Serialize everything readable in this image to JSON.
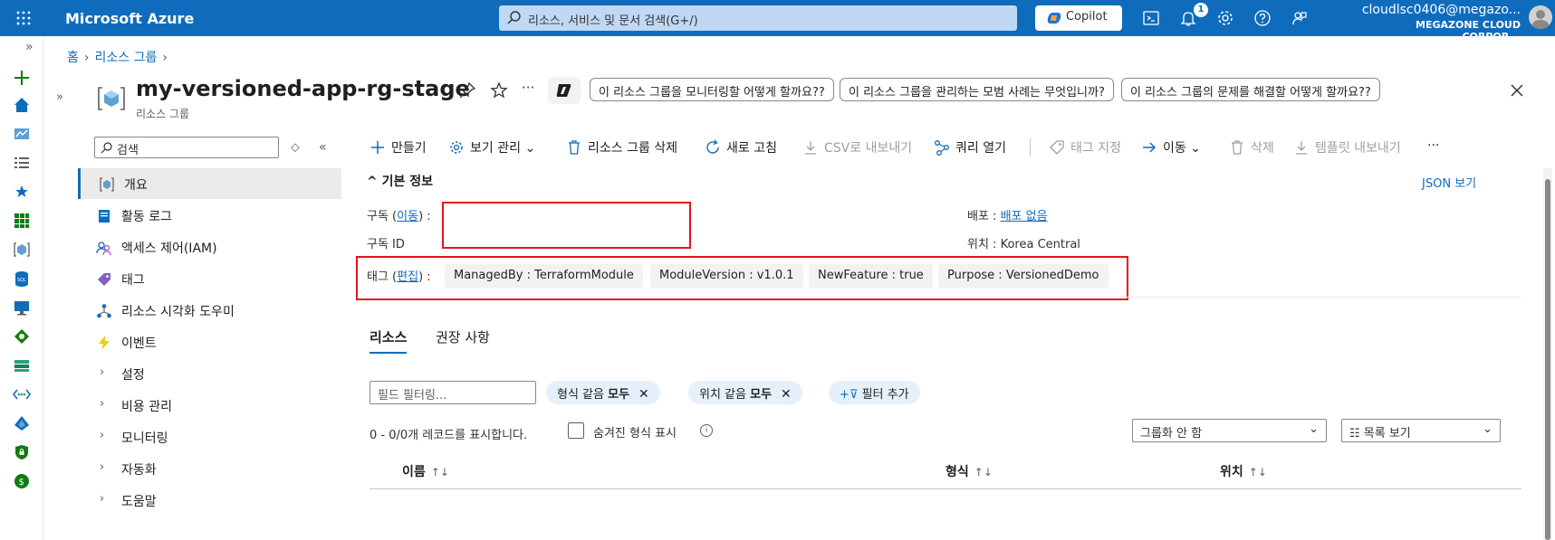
{
  "topbar": {
    "brand": "Microsoft Azure",
    "search_placeholder": "리소스, 서비스 및 문서 검색(G+/)",
    "copilot_label": "Copilot",
    "notification_count": "1",
    "user_email": "cloudlsc0406@megazo...",
    "user_org": "MEGAZONE CLOUD CORPOR..."
  },
  "breadcrumb": {
    "home": "홈",
    "resource_groups": "리소스 그룹"
  },
  "header": {
    "title": "my-versioned-app-rg-stage",
    "subtitle": "리소스 그룹",
    "more": "···",
    "suggestions": [
      "이 리소스 그룹을 모니터링할 어떻게 할까요??",
      "이 리소스 그룹을 관리하는 모범 사례는 무엇입니까?",
      "이 리소스 그룹의 문제를 해결할 어떻게 할까요??"
    ]
  },
  "menu": {
    "search_placeholder": "검색",
    "items": [
      {
        "label": "개요"
      },
      {
        "label": "활동 로그"
      },
      {
        "label": "액세스 제어(IAM)"
      },
      {
        "label": "태그"
      },
      {
        "label": "리소스 시각화 도우미"
      },
      {
        "label": "이벤트"
      },
      {
        "label": "설정"
      },
      {
        "label": "비용 관리"
      },
      {
        "label": "모니터링"
      },
      {
        "label": "자동화"
      },
      {
        "label": "도움말"
      }
    ]
  },
  "commands": {
    "create": "만들기",
    "manage_view": "보기 관리",
    "delete_rg": "리소스 그룹 삭제",
    "refresh": "새로 고침",
    "export_csv": "CSV로 내보내기",
    "open_query": "쿼리 열기",
    "assign_tags": "태그 지정",
    "move": "이동",
    "delete": "삭제",
    "export_template": "템플릿 내보내기",
    "more": "···"
  },
  "essentials": {
    "heading": "기본 정보",
    "json_view": "JSON 보기",
    "subscription_label": "구독",
    "subscription_move": "이동",
    "subscription_id_label": "구독 ID",
    "deployment_label": "배포",
    "deployment_value": "배포 없음",
    "location_label": "위치",
    "location_value": "Korea Central",
    "tags_label": "태그",
    "tags_edit": "편집",
    "tags": [
      "ManagedBy : TerraformModule",
      "ModuleVersion : v1.0.1",
      "NewFeature : true",
      "Purpose : VersionedDemo"
    ]
  },
  "tabs": {
    "resources": "리소스",
    "recommendations": "권장 사항"
  },
  "filters": {
    "placeholder": "필드 필터링...",
    "type_prefix": "형식 같음",
    "type_value": "모두",
    "location_prefix": "위치 같음",
    "location_value": "모두",
    "add_filter": "필터 추가"
  },
  "records": {
    "summary": "0 - 0/0개 레코드를 표시합니다.",
    "show_hidden": "숨겨진 형식 표시",
    "grouping": "그룹화 안 함",
    "view": "목록 보기"
  },
  "table": {
    "columns": [
      "이름",
      "형식",
      "위치"
    ]
  }
}
